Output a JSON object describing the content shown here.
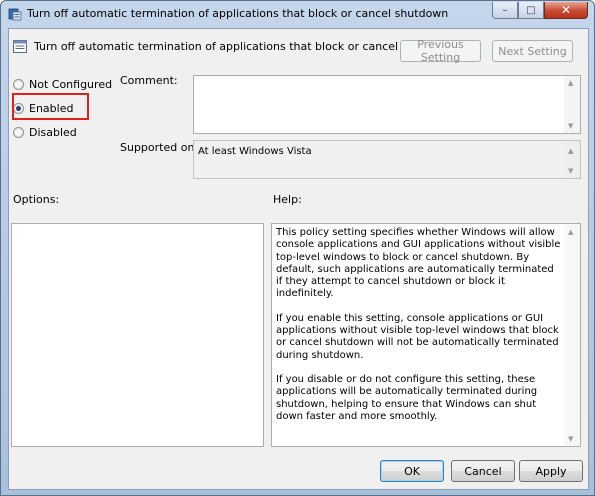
{
  "window": {
    "title": "Turn off automatic termination of applications that block or cancel shutdown",
    "icon": "policy-icon",
    "controls": {
      "minimize": "–",
      "maximize": "□",
      "close": "✕"
    }
  },
  "header": {
    "title": "Turn off automatic termination of applications that block or cancel shutdown",
    "icon": "setting-icon",
    "previous_label": "Previous Setting",
    "next_label": "Next Setting"
  },
  "state": {
    "options": [
      {
        "label": "Not Configured",
        "checked": false
      },
      {
        "label": "Enabled",
        "checked": true
      },
      {
        "label": "Disabled",
        "checked": false
      }
    ]
  },
  "comment": {
    "label": "Comment:",
    "value": ""
  },
  "supported": {
    "label": "Supported on:",
    "value": "At least Windows Vista"
  },
  "options_panel": {
    "label": "Options:"
  },
  "help_panel": {
    "label": "Help:",
    "paragraphs": [
      "This policy setting specifies whether Windows will allow console applications and GUI applications without visible top-level windows to block or cancel shutdown. By default, such applications are automatically terminated if they attempt to cancel shutdown or block it indefinitely.",
      "If you enable this setting, console applications or GUI applications without visible top-level windows that block or cancel shutdown will not be automatically terminated during shutdown.",
      "If you disable or do not configure this setting, these applications will be automatically terminated during shutdown, helping to ensure that Windows can shut down faster and more smoothly."
    ]
  },
  "footer": {
    "ok_label": "OK",
    "cancel_label": "Cancel",
    "apply_label": "Apply"
  },
  "colors": {
    "highlight": "#e0201a",
    "client_bg": "#f0f0f0"
  }
}
